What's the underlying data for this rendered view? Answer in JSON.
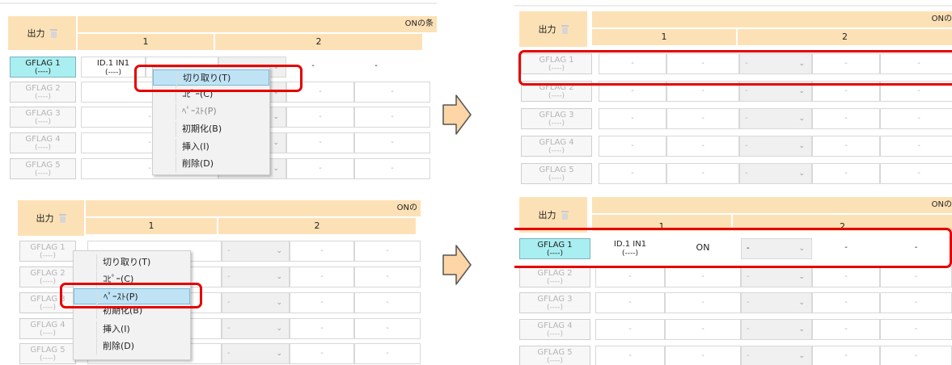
{
  "header": {
    "output_label": "出力",
    "on_label": "ONの",
    "on_label_cut": "ONの条",
    "col1": "1",
    "col2": "2"
  },
  "row_labels": [
    "GFLAG 1",
    "GFLAG 2",
    "GFLAG 3",
    "GFLAG 4",
    "GFLAG 5"
  ],
  "row_sub": "(----)",
  "cell_value": "ID.1 IN1",
  "on_value": "ON",
  "dash": "-",
  "menu": {
    "cut": "切り取り(T)",
    "copy": "ｺﾋﾟｰ(C)",
    "paste": "ﾍﾟｰｽﾄ(P)",
    "init": "初期化(B)",
    "insert": "挿入(I)",
    "delete": "削除(D)"
  },
  "colors": {
    "header_bg": "#fde1b6",
    "active_row": "#a9eef0",
    "highlight": "#e60000",
    "arrow_fill": "#fdd5a6",
    "menu_hover": "#bfe3f5"
  }
}
